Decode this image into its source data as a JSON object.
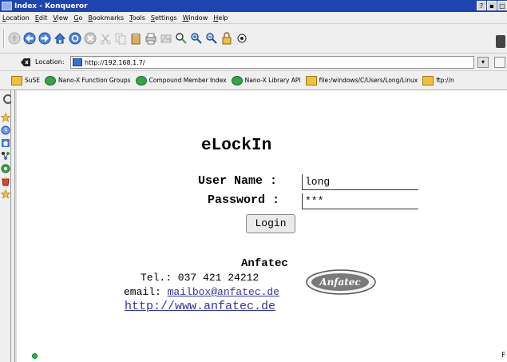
{
  "window": {
    "title": "Index - Konqueror",
    "controls": [
      "?",
      "▪",
      "□"
    ]
  },
  "menubar": {
    "items": [
      {
        "label": "Location",
        "key": "L",
        "rest": "ocation"
      },
      {
        "label": "Edit",
        "key": "E",
        "rest": "dit"
      },
      {
        "label": "View",
        "key": "V",
        "rest": "iew"
      },
      {
        "label": "Go",
        "key": "G",
        "rest": "o"
      },
      {
        "label": "Bookmarks",
        "key": "B",
        "rest": "ookmarks"
      },
      {
        "label": "Tools",
        "key": "T",
        "rest": "ools"
      },
      {
        "label": "Settings",
        "key": "S",
        "rest": "ettings"
      },
      {
        "label": "Window",
        "key": "W",
        "rest": "indow"
      },
      {
        "label": "Help",
        "key": "H",
        "rest": "elp"
      }
    ]
  },
  "location": {
    "label": "Location:",
    "url": "http://192.168.1.7/"
  },
  "bookmarks": [
    {
      "label": "SuSE",
      "icon": "folder-icon"
    },
    {
      "label": "Nano-X Function Groups",
      "icon": "konqueror-icon"
    },
    {
      "label": "Compound Member Index",
      "icon": "konqueror-icon"
    },
    {
      "label": "Nano-X Library API",
      "icon": "konqueror-icon"
    },
    {
      "label": "file:/windows/C/Users/Long/Linux",
      "icon": "folder-icon"
    },
    {
      "label": "ftp://n",
      "icon": "folder-icon"
    }
  ],
  "page": {
    "title": "eLockIn",
    "username_label": "User Name :",
    "username_value": "long",
    "password_label": "Password :",
    "password_value": "***",
    "login_label": "Login",
    "company": "Anfatec",
    "tel": "Tel.: 037 421 24212",
    "email_prefix": "email: ",
    "email": "mailbox@anfatec.de",
    "website": "http://www.anfatec.de",
    "logo_text": "Anfatec"
  },
  "colors": {
    "titlebar": "#1e44b0",
    "link": "#3333aa",
    "status_led": "#20c040"
  },
  "status": {
    "right_text": "F"
  }
}
